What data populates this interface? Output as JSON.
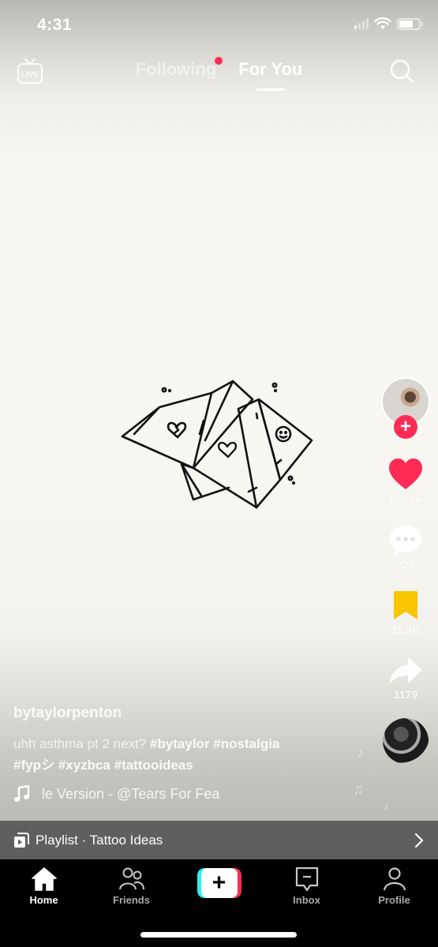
{
  "status_bar": {
    "time": "4:31"
  },
  "top_nav": {
    "live_label": "LIVE",
    "tabs": [
      {
        "label": "Following",
        "active": false,
        "notification_dot": true
      },
      {
        "label": "For You",
        "active": true
      }
    ],
    "search_icon": "search-icon"
  },
  "video": {
    "artwork": "paper-fortune-teller-drawing",
    "colors": {
      "accent": "#fe2c55",
      "bookmark": "#f8c500"
    }
  },
  "rail": {
    "follow_label": "+",
    "likes": "122.9K",
    "comments": "779",
    "bookmarks": "11.3K",
    "shares": "1179"
  },
  "caption": {
    "username": "bytaylorpenton",
    "text": "uhh asthma pt 2 next?",
    "hashtags_line1": [
      "#bytaylor",
      "#nostalgia"
    ],
    "hashtags_line2": [
      "#fypシ",
      "#xyzbca",
      "#tattooideas"
    ],
    "music": "le Version - @Tears For Fea"
  },
  "playlist": {
    "label": "Playlist · Tattoo Ideas"
  },
  "bottom_nav": {
    "items": [
      {
        "label": "Home",
        "icon": "home-icon",
        "active": true
      },
      {
        "label": "Friends",
        "icon": "friends-icon"
      },
      {
        "label": "",
        "icon": "create-icon",
        "create_symbol": "+"
      },
      {
        "label": "Inbox",
        "icon": "inbox-icon"
      },
      {
        "label": "Profile",
        "icon": "profile-icon"
      }
    ]
  }
}
